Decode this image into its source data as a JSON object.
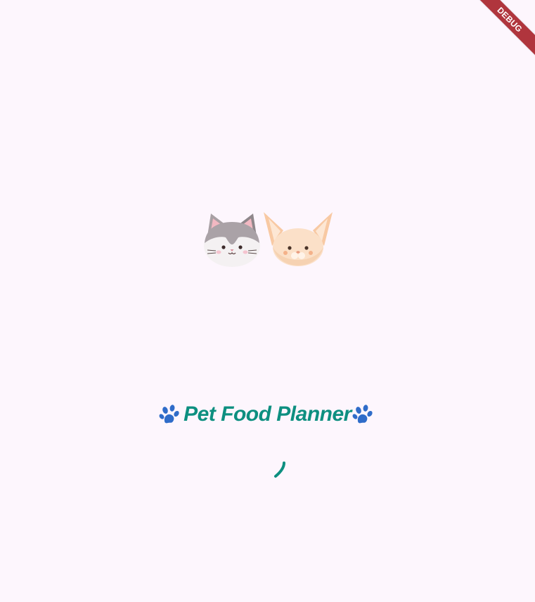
{
  "app": {
    "title": "Pet Food Planner",
    "debug_banner_label": "DEBUG"
  },
  "icons": {
    "left_decoration": "paw-prints-icon",
    "right_decoration": "paw-prints-icon",
    "mascot_cat": "cat-face-icon",
    "mascot_fox": "fennec-fox-face-icon",
    "loading": "loading-spinner"
  },
  "colors": {
    "background": "#fdf6fd",
    "title": "#0d8f80",
    "paw": "#2f6cc9",
    "spinner": "#0d8f80",
    "debug_banner": "#b0353d"
  }
}
